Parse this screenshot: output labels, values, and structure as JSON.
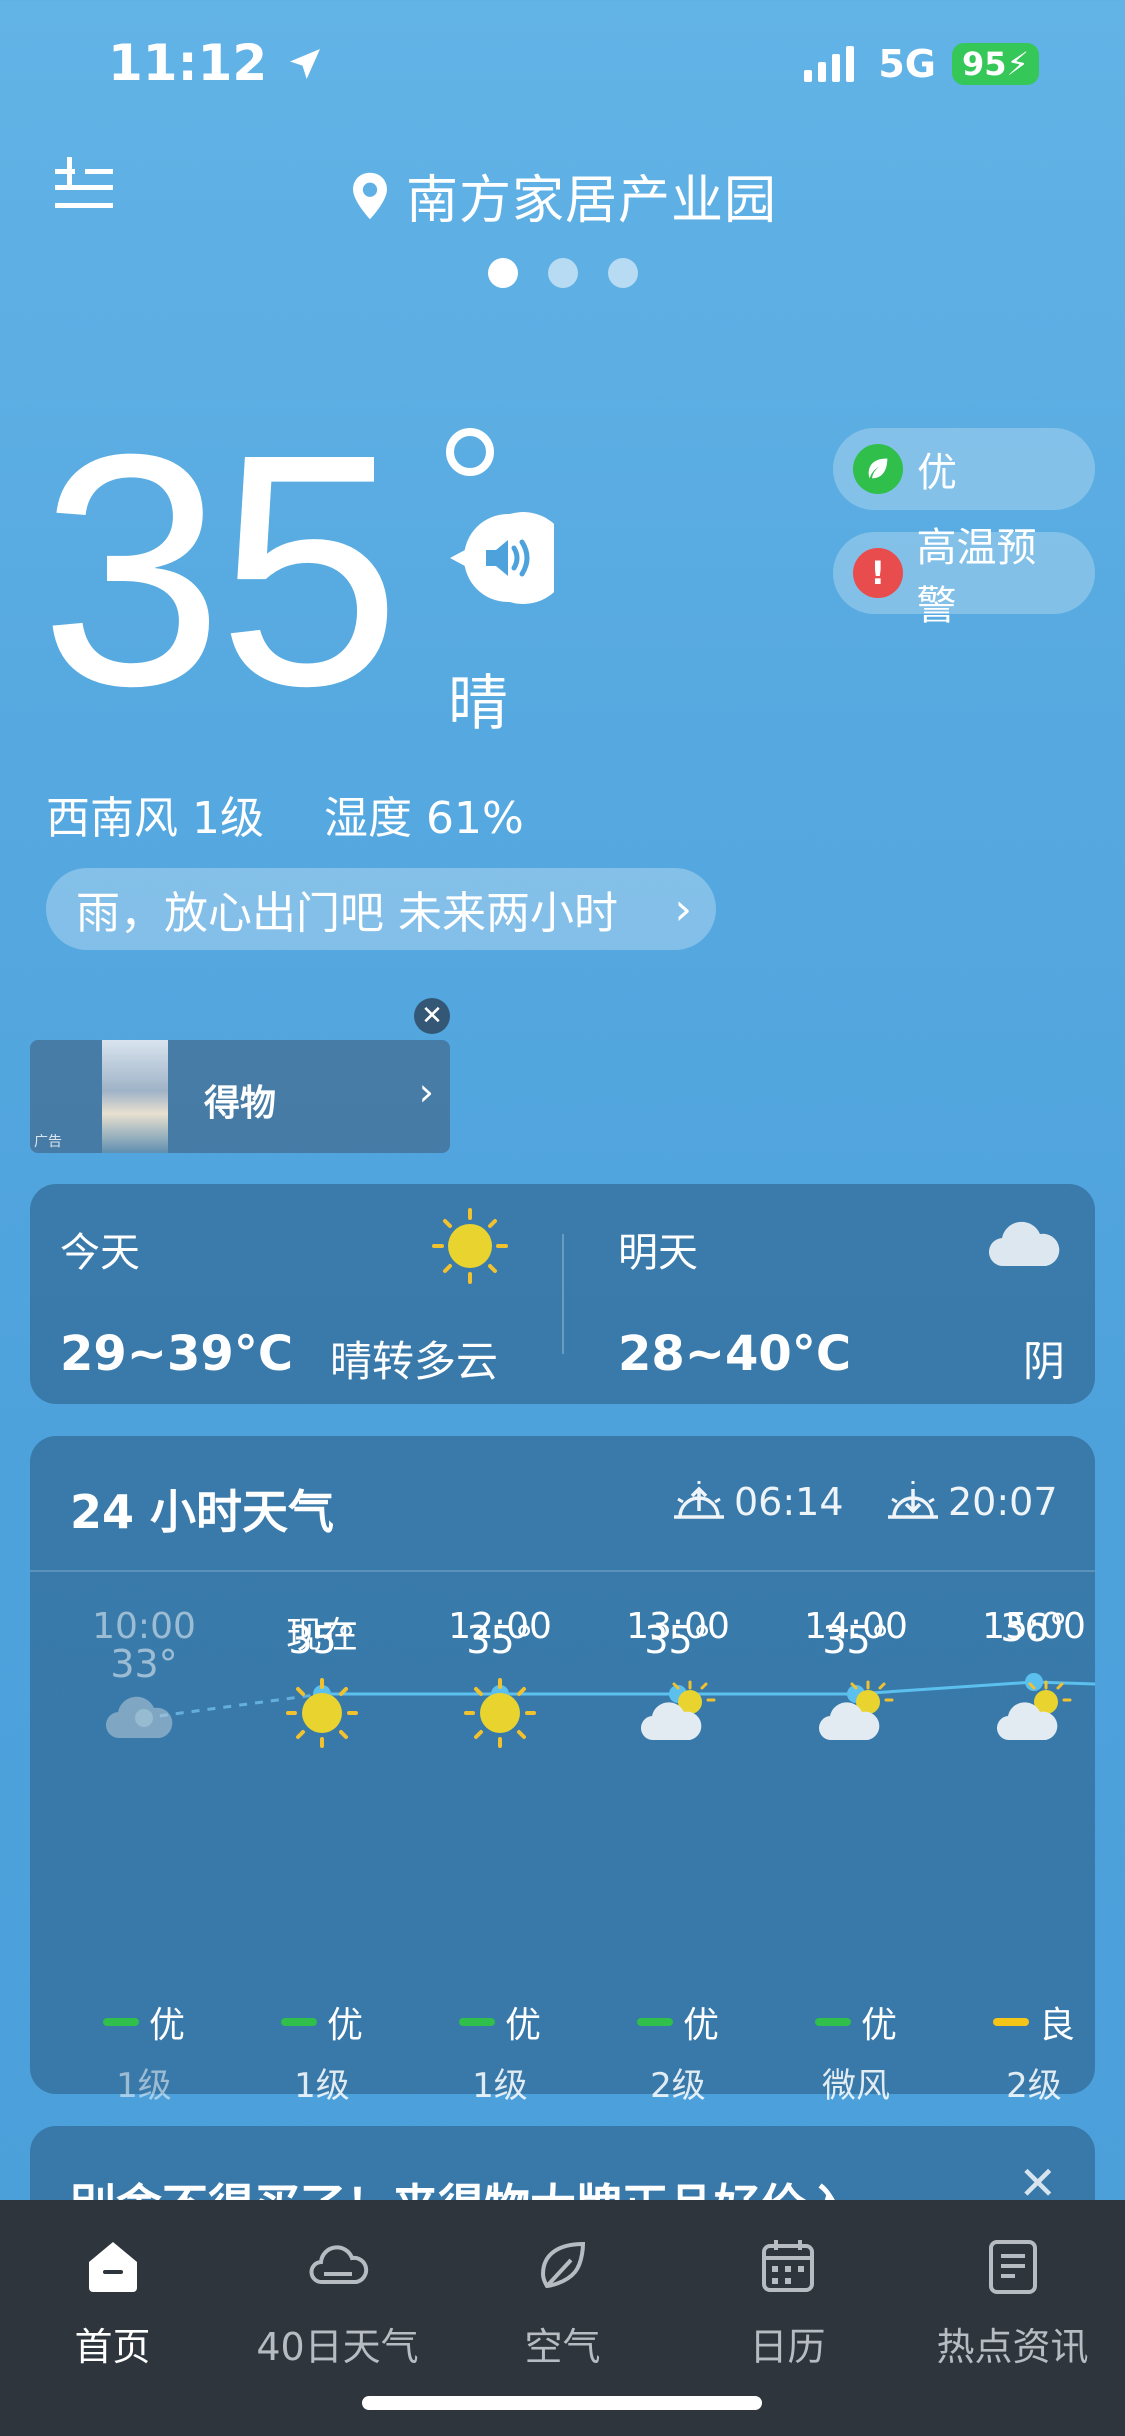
{
  "status_bar": {
    "time": "11:12",
    "network": "5G",
    "battery": "95"
  },
  "header": {
    "location": "南方家居产业园",
    "page_count": 3,
    "active_page": 0
  },
  "current": {
    "temperature": "35",
    "condition": "晴",
    "wind": "西南风 1级",
    "humidity": "湿度 61%",
    "tip": "雨，放心出门吧  未来两小时"
  },
  "badges": {
    "aqi": "优",
    "warning": "高温预警"
  },
  "ad_banner": {
    "title": "得物",
    "tag": "广告"
  },
  "today": {
    "label": "今天",
    "temp": "29~39°C",
    "desc": "晴转多云"
  },
  "tomorrow": {
    "label": "明天",
    "temp": "28~40°C",
    "desc": "阴"
  },
  "hourly": {
    "title": "24 小时天气",
    "sunrise": "06:14",
    "sunset": "20:07",
    "items": [
      {
        "time": "10:00",
        "icon": "cloud-icon",
        "temp": "33°",
        "temp_value": 33,
        "aqi": "优",
        "aqi_color": "#2fbf4a",
        "wind": "1级"
      },
      {
        "time": "现在",
        "icon": "sun-icon",
        "temp": "35°",
        "temp_value": 35,
        "aqi": "优",
        "aqi_color": "#2fbf4a",
        "wind": "1级"
      },
      {
        "time": "12:00",
        "icon": "sun-icon",
        "temp": "35°",
        "temp_value": 35,
        "aqi": "优",
        "aqi_color": "#2fbf4a",
        "wind": "1级"
      },
      {
        "time": "13:00",
        "icon": "partly-cloudy-icon",
        "temp": "35°",
        "temp_value": 35,
        "aqi": "优",
        "aqi_color": "#2fbf4a",
        "wind": "2级"
      },
      {
        "time": "14:00",
        "icon": "partly-cloudy-icon",
        "temp": "35°",
        "temp_value": 35,
        "aqi": "优",
        "aqi_color": "#2fbf4a",
        "wind": "微风"
      },
      {
        "time": "15:00",
        "icon": "partly-cloudy-icon",
        "temp": "36°",
        "temp_value": 36,
        "aqi": "良",
        "aqi_color": "#f5c518",
        "wind": "2级"
      }
    ]
  },
  "ad_card": {
    "text": "别舍不得买了！来得物大牌正品好价入"
  },
  "tabbar": {
    "tabs": [
      {
        "label": "首页",
        "icon": "home-icon"
      },
      {
        "label": "40日天气",
        "icon": "cloud-icon"
      },
      {
        "label": "空气",
        "icon": "leaf-icon"
      },
      {
        "label": "日历",
        "icon": "calendar-icon"
      },
      {
        "label": "热点资讯",
        "icon": "news-icon"
      }
    ],
    "active": 0
  },
  "colors": {
    "aqi_good": "#2fbf4a",
    "aqi_moderate": "#f5c518",
    "warning": "#e84c4c",
    "battery": "#36c759"
  }
}
